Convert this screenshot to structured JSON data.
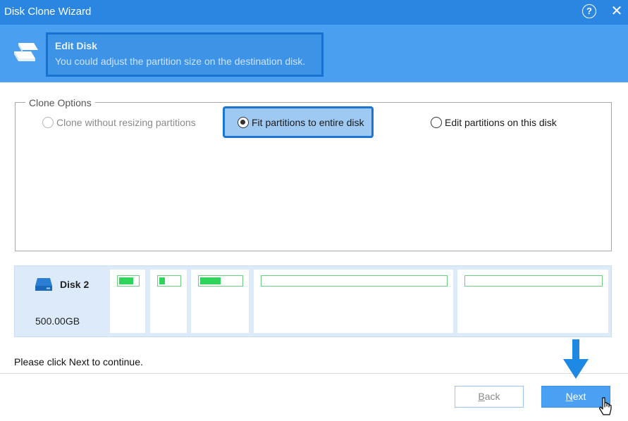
{
  "window": {
    "title": "Disk Clone Wizard",
    "help_icon": "question-circle-icon",
    "close_icon": "close-icon"
  },
  "header": {
    "title": "Edit Disk",
    "subtitle": "You could adjust the partition size on the destination disk.",
    "icon": "disk-clone-icon"
  },
  "clone_options": {
    "legend": "Clone Options",
    "options": [
      {
        "label": "Clone without resizing partitions",
        "selected": false,
        "enabled": false
      },
      {
        "label": "Fit partitions to entire disk",
        "selected": true,
        "enabled": true
      },
      {
        "label": "Edit partitions on this disk",
        "selected": false,
        "enabled": true
      }
    ]
  },
  "disk": {
    "name": "Disk 2",
    "size": "500.00GB",
    "icon": "hard-drive-icon",
    "partitions": [
      {
        "used_fraction": 0.75
      },
      {
        "used_fraction": 0.3
      },
      {
        "used_fraction": 0.5
      },
      {
        "used_fraction": 0.0
      },
      {
        "used_fraction": 0.0
      }
    ]
  },
  "status_text": "Please click Next to continue.",
  "buttons": {
    "back_prefix": "",
    "back_mnemonic": "B",
    "back_rest": "ack",
    "next_prefix": "",
    "next_mnemonic": "N",
    "next_rest": "ext"
  },
  "colors": {
    "titlebar": "#2b86e2",
    "header": "#4a9ff0",
    "highlight_border": "#1a76d2",
    "partition_fill": "#2fd45a",
    "arrow": "#1e88e5"
  }
}
